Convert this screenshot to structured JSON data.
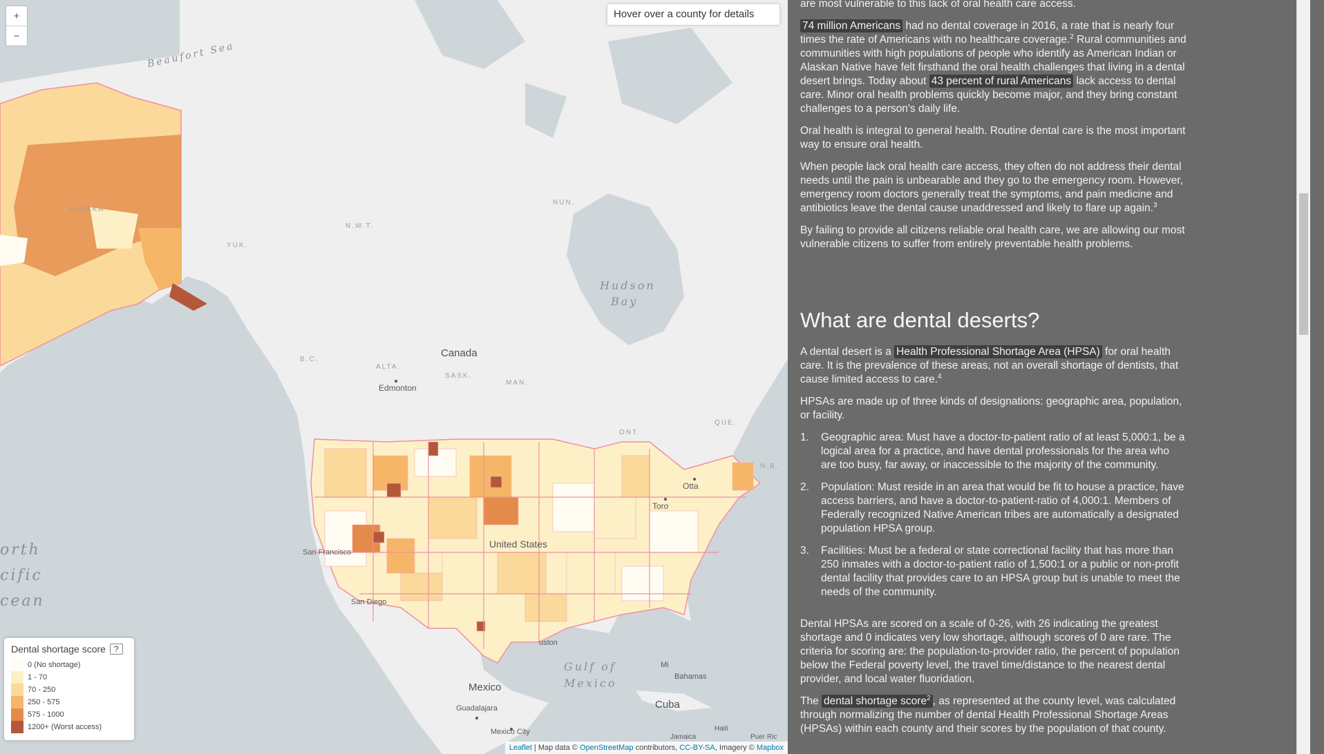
{
  "map": {
    "zoom_in": "+",
    "zoom_out": "−",
    "hover_box": "Hover over a county for details",
    "labels": {
      "beaufort": "Beaufort Sea",
      "hudson1": "Hudson",
      "hudson2": "Bay",
      "north_pacific": [
        "orth",
        "cific",
        "cean"
      ],
      "gulf1": "Gulf of",
      "gulf2": "Mexico",
      "canada": "Canada",
      "mexico": "Mexico",
      "cuba": "Cuba",
      "united_states": "United States",
      "alaska": "ALASKA",
      "yuk": "YUK.",
      "nwt": "N.W.T.",
      "nun": "NUN.",
      "bc": "B.C.",
      "alta": "ALTA.",
      "sask": "SASK.",
      "man": "MAN.",
      "ont": "ONT.",
      "que": "QUE.",
      "nb": "N.B.",
      "edmonton": "Edmonton",
      "toronto": "Toro",
      "ottawa": "Otta",
      "san_francisco": "San Francisco",
      "san_diego": "San Diego",
      "houston": "uston",
      "miami": "Mi",
      "bahamas": "Bahamas",
      "guadalajara": "Guadalajara",
      "mexico_city": "Mexico City",
      "haiti": "Haiti",
      "jamaica": "Jamaica",
      "puerto_rico": "Puer Ric"
    },
    "legend": {
      "title": "Dental shortage score",
      "help": "?",
      "items": [
        {
          "label": "0 (No shortage)",
          "color": "#fffdf3"
        },
        {
          "label": "1 - 70",
          "color": "#fdf0c7"
        },
        {
          "label": "70 - 250",
          "color": "#fbd99a"
        },
        {
          "label": "250 - 575",
          "color": "#f6b667"
        },
        {
          "label": "575 - 1000",
          "color": "#e48b4a"
        },
        {
          "label": "1200+ (Worst access)",
          "color": "#b4573a"
        }
      ]
    },
    "attribution": {
      "leaflet": "Leaflet",
      "map_data": " | Map data © ",
      "osm": "OpenStreetMap",
      "contributors": " contributors, ",
      "ccbysa": "CC-BY-SA",
      "imagery": ", Imagery © ",
      "mapbox": "Mapbox"
    },
    "colors": {
      "land": "#efefef",
      "water": "#cfd6da",
      "border": "#f08ea0"
    }
  },
  "article": {
    "top_line": "are most vulnerable to this lack of oral health care access.",
    "p1": {
      "hl1": "74 million Americans",
      "t1": " had no dental coverage in 2016, a rate that is nearly four times the rate of Americans with no healthcare coverage.",
      "sup1": "2",
      "t2": " Rural communities and communities with high populations of people who identify as American Indian or Alaskan Native have felt firsthand the oral health challenges that living in a dental desert brings. Today about ",
      "hl2": "43 percent of rural Americans",
      "t3": " lack access to dental care. Minor oral health problems quickly become major, and they bring constant challenges to a person's daily life."
    },
    "p2": "Oral health is integral to general health. Routine dental care is the most important way to ensure oral health.",
    "p3": {
      "text": "When people lack oral health care access, they often do not address their dental needs until the pain is unbearable and they go to the emergency room. However, emergency room doctors generally treat the symptoms, and pain medicine and antibiotics leave the dental cause unaddressed and likely to flare up again.",
      "sup": "3"
    },
    "p4": "By failing to provide all citizens reliable oral health care, we are allowing our most vulnerable citizens to suffer from entirely preventable health problems.",
    "heading": "What are dental deserts?",
    "p5": {
      "t1": "A dental desert is a ",
      "hl": "Health Professional Shortage Area (HPSA)",
      "t2": " for oral health care. It is the prevalence of these areas, not an overall shortage of dentists, that cause limited access to care.",
      "sup": "4"
    },
    "p6": "HPSAs are made up of three kinds of designations: geographic area, population, or facility.",
    "list": [
      {
        "num": "1.",
        "text": "Geographic area: Must have a doctor-to-patient ratio of at least 5,000:1, be a logical area for a practice, and have dental professionals for the area who are too busy, far away, or inaccessible to the majority of the community."
      },
      {
        "num": "2.",
        "text": "Population: Must reside in an area that would be fit to house a practice, have access barriers, and have a doctor-to-patient-ratio of 4,000:1. Members of Federally recognized Native American tribes are automatically a designated population HPSA group."
      },
      {
        "num": "3.",
        "text": "Facilities: Must be a federal or state correctional facility that has more than 250 inmates with a doctor-to-patient ratio of 1,500:1 or a public or non-profit dental facility that provides care to an HPSA group but is unable to meet the needs of the community."
      }
    ],
    "p7": "Dental HPSAs are scored on a scale of 0-26, with 26 indicating the greatest shortage and 0 indicates very low shortage, although scores of 0 are rare. The criteria for scoring are: the population-to-provider ratio, the percent of population below the Federal poverty level, the travel time/distance to the nearest dental provider, and local water fluoridation.",
    "p8": {
      "t1": "The ",
      "hl": "dental shortage score",
      "sup": "2",
      "t2": ", as represented at the county level, was calculated through normalizing the number of dental Health Professional Shortage Areas (HPSAs) within each county and their scores by the population of that county."
    }
  }
}
